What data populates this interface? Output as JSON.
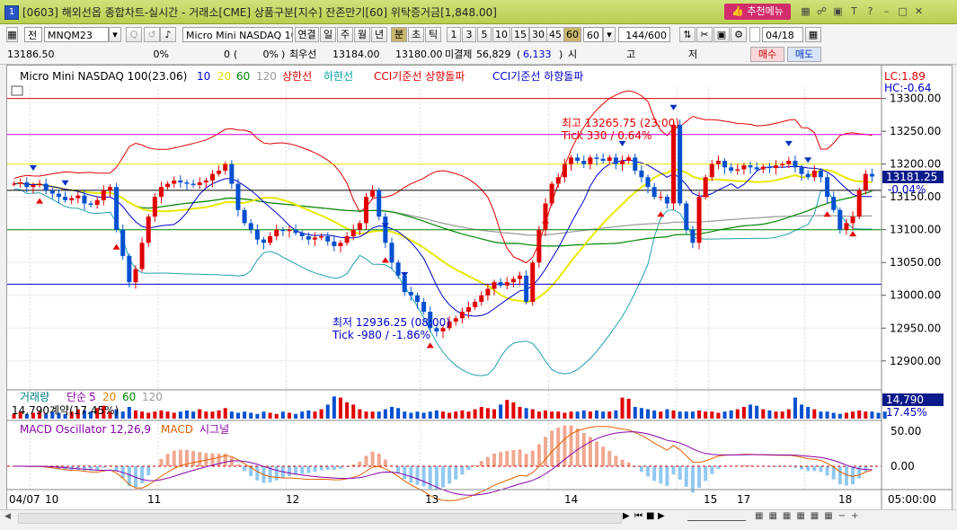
{
  "window": {
    "title": "[0603] 해외선옵 종합차트-실시간 - 거래소[CME] 상품구분[지수] 잔존만기[60] 위탁증거금[1,848.00]",
    "app_icon": "1",
    "recommend_menu": "추천메뉴",
    "right_icons": [
      "layout-icon",
      "link-icon",
      "window-icon",
      "font-icon",
      "help-icon",
      "minimize-icon",
      "maximize-icon",
      "close-icon"
    ]
  },
  "toolbar1": {
    "mode": "전",
    "symbol": "MNQM23",
    "product_name": "Micro Mini NASDAQ 10",
    "buttons": [
      "연결",
      "일",
      "주",
      "월",
      "년",
      "분",
      "초",
      "틱"
    ],
    "selected_button": "분",
    "intervals": [
      "1",
      "3",
      "5",
      "10",
      "15",
      "30",
      "45",
      "60"
    ],
    "selected_interval": "60",
    "interval_select": "60",
    "count": "144/600",
    "date": "04/18"
  },
  "toolbar2": {
    "last_price": "13186.50",
    "change": "0",
    "change_pct": "0%",
    "volume": "0",
    "volume_pct": "0%",
    "best_ask_label": "최우선",
    "best_ask": "13184.00",
    "best_bid": "13180.00",
    "open_interest_label": "미결제",
    "open_interest": "56,829",
    "oi_change": "6,133",
    "ohl": [
      "시",
      "고",
      "저"
    ],
    "buy": "매수",
    "sell": "매도"
  },
  "legend": {
    "name": "Micro Mini NASDAQ 100(23.06)",
    "ma": [
      {
        "p": "10",
        "color": "#0000cc"
      },
      {
        "p": "20",
        "color": "#dcdc00"
      },
      {
        "p": "60",
        "color": "#008800"
      },
      {
        "p": "120",
        "color": "#999999"
      }
    ],
    "upper": "상한선",
    "lower": "하한선",
    "cci_up": "CCI기준선 상향돌파",
    "cci_down": "CCI기준선 하향돌파",
    "lc": "LC:1.89",
    "hc": "HC:-0.64"
  },
  "annotations": {
    "high_line1": "최고 13265.75 (23:00)",
    "high_line2": "Tick 330 / 0.64%",
    "low_line1": "최저 12936.25 (08:00)",
    "low_line2": "Tick -980 / -1.86%"
  },
  "price_axis": {
    "ticks": [
      "13300.00",
      "13250.00",
      "13200.00",
      "13150.00",
      "13100.00",
      "13050.00",
      "13000.00",
      "12950.00",
      "12900.00"
    ],
    "current": "13181.25",
    "current_pct": "-0.04%"
  },
  "volume_panel": {
    "title": "거래량",
    "ma_label": "단순",
    "ma": [
      "5",
      "20",
      "60",
      "120"
    ],
    "value": "14,790계약(17.45%)",
    "right_value": "14,790",
    "right_pct": "17.45%"
  },
  "macd_panel": {
    "title": "MACD Oscillator 12,26,9",
    "macd": "MACD",
    "signal": "시그널",
    "ticks": [
      "50.00",
      "0.00",
      "-50.00"
    ]
  },
  "x_axis": {
    "labels": [
      "04/07",
      "10",
      "11",
      "12",
      "13",
      "14",
      "15",
      "17",
      "18"
    ],
    "time": "05:00:00"
  },
  "chart_data": {
    "type": "candlestick",
    "title": "Micro Mini NASDAQ 100(23.06)",
    "ylim": [
      12860,
      13320
    ],
    "hlines": [
      {
        "value": 13300,
        "color": "#e00000"
      },
      {
        "value": 13245,
        "color": "#d000d0"
      },
      {
        "value": 13200,
        "color": "#e8e800"
      },
      {
        "value": 13160,
        "color": "#000000"
      },
      {
        "value": 13100,
        "color": "#008800"
      },
      {
        "value": 13017,
        "color": "#0000cc"
      }
    ],
    "closes": [
      13170,
      13172,
      13165,
      13168,
      13170,
      13160,
      13155,
      13150,
      13145,
      13148,
      13152,
      13140,
      13138,
      13145,
      13160,
      13165,
      13100,
      13060,
      13020,
      13040,
      13080,
      13120,
      13150,
      13165,
      13170,
      13175,
      13172,
      13170,
      13168,
      13172,
      13175,
      13185,
      13190,
      13200,
      13170,
      13130,
      13110,
      13100,
      13085,
      13080,
      13090,
      13100,
      13098,
      13100,
      13095,
      13090,
      13085,
      13088,
      13090,
      13082,
      13075,
      13080,
      13090,
      13100,
      13110,
      13150,
      13160,
      13120,
      13080,
      13050,
      13030,
      13005,
      13000,
      12990,
      12975,
      12950,
      12945,
      12950,
      12960,
      12965,
      12975,
      12982,
      12990,
      13000,
      13010,
      13020,
      13015,
      13020,
      13025,
      13030,
      12990,
      13050,
      13100,
      13140,
      13170,
      13180,
      13200,
      13210,
      13205,
      13200,
      13210,
      13208,
      13205,
      13210,
      13200,
      13205,
      13210,
      13190,
      13180,
      13165,
      13150,
      13150,
      13140,
      13260,
      13140,
      13100,
      13080,
      13150,
      13180,
      13200,
      13205,
      13195,
      13190,
      13192,
      13198,
      13195,
      13192,
      13196,
      13194,
      13198,
      13200,
      13205,
      13195,
      13185,
      13180,
      13190,
      13180,
      13150,
      13130,
      13100,
      13110,
      13120,
      13160,
      13185,
      13181
    ],
    "volume_heights": [
      0.2,
      0.3,
      0.2,
      0.25,
      0.3,
      0.2,
      0.3,
      0.25,
      0.2,
      0.3,
      0.4,
      0.35,
      0.3,
      0.45,
      0.55,
      0.3,
      0.4,
      0.3,
      0.5,
      0.35,
      0.3,
      0.25,
      0.3,
      0.35,
      0.3,
      0.25,
      0.3,
      0.35,
      0.3,
      0.4,
      0.3,
      0.3,
      0.35,
      0.45,
      0.3,
      0.25,
      0.3,
      0.25,
      0.2,
      0.3,
      0.25,
      0.2,
      0.3,
      0.25,
      0.2,
      0.3,
      0.35,
      0.3,
      0.4,
      0.6,
      0.95,
      0.9,
      0.7,
      0.6,
      0.4,
      0.3,
      0.3,
      0.3,
      0.4,
      0.5,
      0.45,
      0.3,
      0.25,
      0.3,
      0.25,
      0.3,
      0.35,
      0.3,
      0.25,
      0.3,
      0.35,
      0.3,
      0.4,
      0.5,
      0.45,
      0.4,
      0.6,
      0.8,
      0.7,
      0.5,
      0.45,
      0.4,
      0.3,
      0.35,
      0.3,
      0.3,
      0.25,
      0.3,
      0.3,
      0.35,
      0.3,
      0.35,
      0.3,
      0.3,
      0.35,
      0.9,
      0.85,
      0.5,
      0.45,
      0.4,
      0.35,
      0.3,
      0.4,
      0.35,
      0.3,
      0.3,
      0.3,
      0.35,
      0.3,
      0.3,
      0.25,
      0.3,
      0.35,
      0.4,
      0.5,
      0.6,
      0.55,
      0.4,
      0.35,
      0.3,
      0.3,
      0.4,
      0.9,
      0.6,
      0.5,
      0.4,
      0.3,
      0.3,
      0.25,
      0.2,
      0.25,
      0.3,
      0.35,
      0.3,
      0.3,
      0.25,
      0.3
    ]
  }
}
